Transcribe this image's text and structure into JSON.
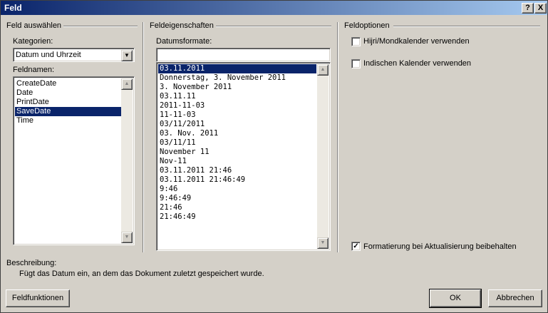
{
  "window": {
    "title": "Feld",
    "help_btn": "?",
    "close_btn": "X"
  },
  "select_field": {
    "group_title": "Feld auswählen",
    "categories_label": "Kategorien:",
    "categories_value": "Datum und Uhrzeit",
    "fieldnames_label": "Feldnamen:",
    "fieldnames": [
      "CreateDate",
      "Date",
      "PrintDate",
      "SaveDate",
      "Time"
    ]
  },
  "field_properties": {
    "group_title": "Feldeigenschaften",
    "formats_label": "Datumsformate:",
    "format_input_value": "",
    "formats": [
      "03.11.2011",
      "Donnerstag, 3. November 2011",
      "3. November 2011",
      "03.11.11",
      "2011-11-03",
      "11-11-03",
      "03/11/2011",
      "03. Nov. 2011",
      "03/11/11",
      "November 11",
      "Nov-11",
      "03.11.2011 21:46",
      "03.11.2011 21:46:49",
      "9:46",
      "9:46:49",
      "21:46",
      "21:46:49"
    ]
  },
  "field_options": {
    "group_title": "Feldoptionen",
    "hijri_label": "Hijri/Mondkalender verwenden",
    "hijri_checked": false,
    "indian_label": "Indischen Kalender verwenden",
    "indian_checked": false,
    "preserve_label": "Formatierung bei Aktualisierung beibehalten",
    "preserve_checked": true
  },
  "description": {
    "label": "Beschreibung:",
    "text": "Fügt das Datum ein, an dem das Dokument zuletzt gespeichert wurde."
  },
  "buttons": {
    "field_codes": "Feldfunktionen",
    "ok": "OK",
    "cancel": "Abbrechen"
  },
  "selection": {
    "fieldname_selected": 3,
    "format_selected": 0
  }
}
